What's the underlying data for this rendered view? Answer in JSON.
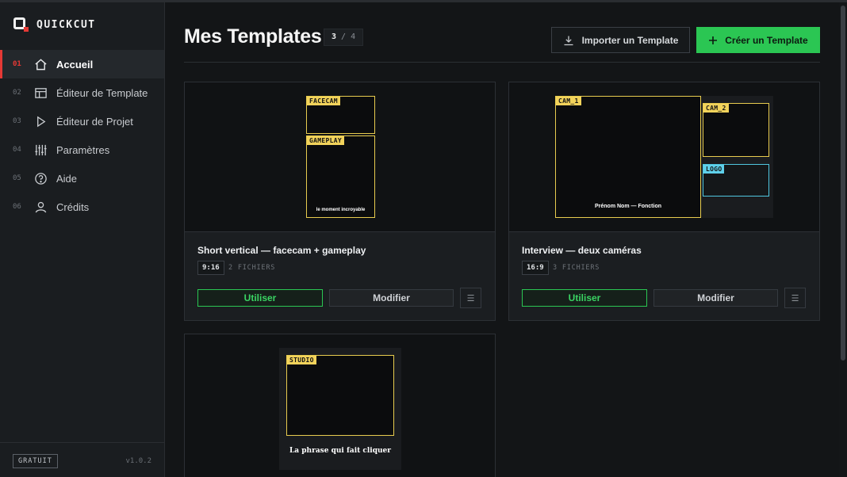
{
  "app": {
    "name": "QUICKCUT",
    "plan": "GRATUIT",
    "version": "v1.0.2"
  },
  "nav": [
    {
      "num": "01",
      "label": "Accueil",
      "icon": "home-icon",
      "active": true
    },
    {
      "num": "02",
      "label": "Éditeur de Template",
      "icon": "layout-icon"
    },
    {
      "num": "03",
      "label": "Éditeur de Projet",
      "icon": "play-icon"
    },
    {
      "num": "04",
      "label": "Paramètres",
      "icon": "sliders-icon"
    },
    {
      "num": "05",
      "label": "Aide",
      "icon": "help-icon"
    },
    {
      "num": "06",
      "label": "Crédits",
      "icon": "user-icon"
    }
  ],
  "header": {
    "title": "Mes Templates",
    "count_current": "3",
    "count_sep": " / ",
    "count_total": "4",
    "import_label": "Importer un Template",
    "create_label": "Créer un Template"
  },
  "templates": [
    {
      "title": "Short vertical — facecam + gameplay",
      "ratio": "9:16",
      "files": "2 FICHIERS",
      "use_label": "Utiliser",
      "edit_label": "Modifier",
      "more_label": "☰",
      "slots": [
        {
          "label": "FACECAM",
          "color": "#e8cc4f"
        },
        {
          "label": "GAMEPLAY",
          "color": "#e8cc4f"
        }
      ],
      "overlay_text": "le moment incroyable"
    },
    {
      "title": "Interview — deux caméras",
      "ratio": "16:9",
      "files": "3 FICHIERS",
      "use_label": "Utiliser",
      "edit_label": "Modifier",
      "more_label": "☰",
      "slots": [
        {
          "label": "CAM_1",
          "color": "#e8cc4f"
        },
        {
          "label": "CAM_2",
          "color": "#e8cc4f"
        },
        {
          "label": "LOGO",
          "color": "#4fc7e0"
        }
      ],
      "overlay_text": "Prénom Nom — Fonction"
    },
    {
      "slots": [
        {
          "label": "STUDIO",
          "color": "#e8cc4f"
        }
      ],
      "overlay_text": "La phrase qui fait cliquer"
    }
  ]
}
